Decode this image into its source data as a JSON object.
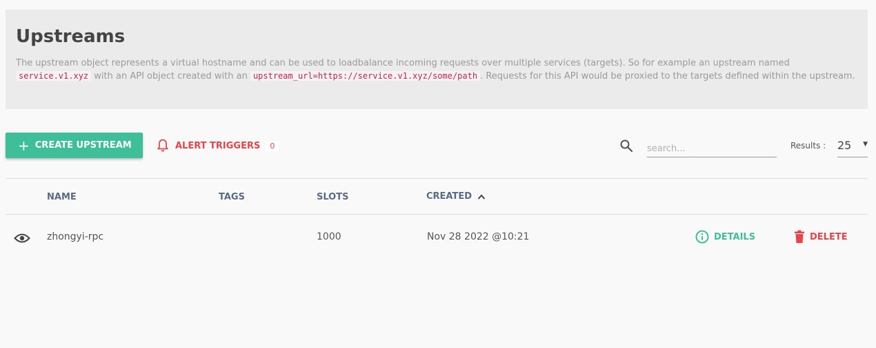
{
  "header": {
    "title": "Upstreams",
    "desc_part1": "The upstream object represents a virtual hostname and can be used to loadbalance incoming requests over multiple services (targets). So for example an upstream named",
    "desc_code1": "service.v1.xyz",
    "desc_part2": "with an API object created with an",
    "desc_code2": "upstream_url=https://service.v1.xyz/some/path",
    "desc_part3": ". Requests for this API would be proxied to the targets defined within the upstream."
  },
  "toolbar": {
    "create_label": "CREATE UPSTREAM",
    "alert_label": "ALERT TRIGGERS",
    "alert_count": "0",
    "search_placeholder": "search...",
    "results_label": "Results :",
    "results_value": "25"
  },
  "table": {
    "columns": {
      "name": "NAME",
      "tags": "TAGS",
      "slots": "SLOTS",
      "created": "CREATED"
    },
    "rows": [
      {
        "name": "zhongyi-rpc",
        "tags": "",
        "slots": "1000",
        "created": "Nov 28 2022 @10:21",
        "details_label": "DETAILS",
        "delete_label": "DELETE"
      }
    ]
  },
  "colors": {
    "accent": "#3fbf99",
    "danger": "#e8444a"
  },
  "icons": {
    "create": "plus-icon",
    "alert": "bell-icon",
    "search": "search-icon",
    "row_view": "eye-icon",
    "details": "info-circle-icon",
    "delete": "trash-icon",
    "sort": "chevron-up-icon"
  }
}
